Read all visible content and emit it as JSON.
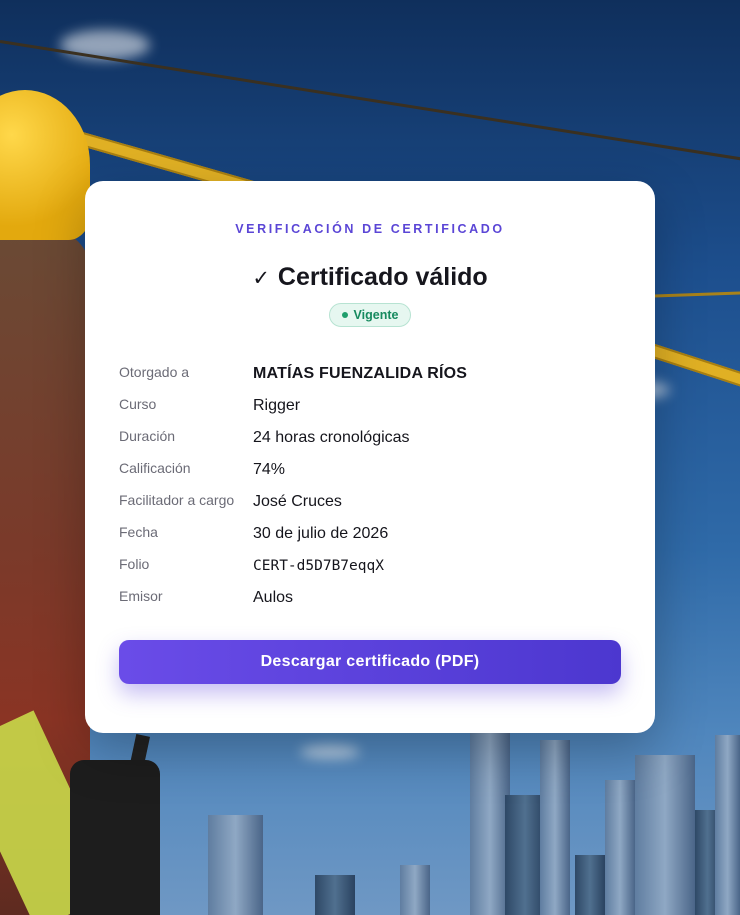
{
  "certificate": {
    "eyebrow": "VERIFICACIÓN DE CERTIFICADO",
    "title_icon": "check-icon",
    "title_check": "✓",
    "title": "Certificado válido",
    "status_badge": "Vigente",
    "fields": [
      {
        "label": "Otorgado a",
        "value": "MATÍAS FUENZALIDA RÍOS"
      },
      {
        "label": "Curso",
        "value": "Rigger"
      },
      {
        "label": "Duración",
        "value": "24 horas cronológicas"
      },
      {
        "label": "Calificación",
        "value": "74%"
      },
      {
        "label": "Facilitador a cargo",
        "value": "José Cruces"
      },
      {
        "label": "Fecha",
        "value": "30 de julio de 2026"
      },
      {
        "label": "Folio",
        "value": "CERT-d5D7B7eqqX"
      },
      {
        "label": "Emisor",
        "value": "Aulos"
      }
    ],
    "download_button": "Descargar certificado (PDF)"
  },
  "colors": {
    "accent": "#5b46d6",
    "badge_green": "#178a5f",
    "button_start": "#6a4ce8",
    "button_end": "#4c37cf"
  }
}
